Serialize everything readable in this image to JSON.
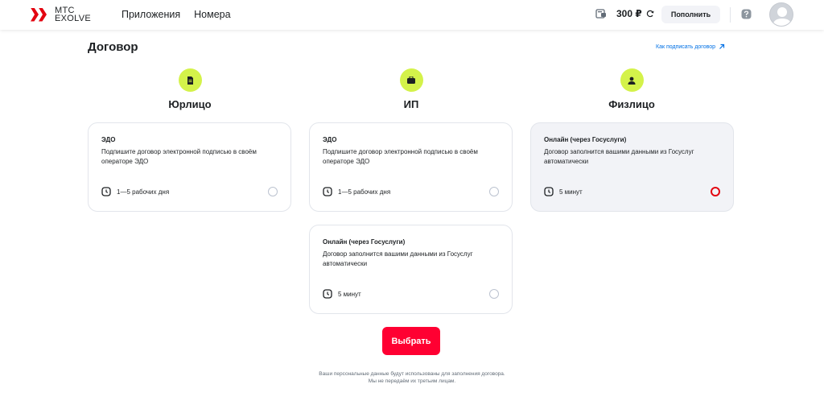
{
  "header": {
    "logo_line1": "МТС",
    "logo_line2": "EXOLVE",
    "nav": [
      "Приложения",
      "Номера"
    ],
    "balance": "300 ₽",
    "topup_label": "Пополнить",
    "icons": [
      "wallet-icon",
      "refresh-icon",
      "help-icon",
      "avatar-icon"
    ]
  },
  "page": {
    "title": "Договор",
    "howto_link": "Как подписать договор"
  },
  "columns": [
    {
      "title": "Юрлицо",
      "icon": "document-icon"
    },
    {
      "title": "ИП",
      "icon": "briefcase-icon"
    },
    {
      "title": "Физлицо",
      "icon": "person-icon"
    }
  ],
  "cards": {
    "ul_edo": {
      "title": "ЭДО",
      "desc": "Подпишите договор электронной подписью в своём операторе ЭДО",
      "time": "1—5 рабочих дня",
      "selected": false
    },
    "ip_edo": {
      "title": "ЭДО",
      "desc": "Подпишите договор электронной подписью в своём операторе ЭДО",
      "time": "1—5 рабочих дня",
      "selected": false
    },
    "ip_online": {
      "title": "Онлайн (через Госуслуги)",
      "desc": "Договор заполнится вашими данными из Госуслуг автоматически",
      "time": "5 минут",
      "selected": false
    },
    "fl_online": {
      "title": "Онлайн (через Госуслуги)",
      "desc": "Договор заполнится вашими данными из Госуслуг автоматически",
      "time": "5 минут",
      "selected": true
    }
  },
  "submit_label": "Выбрать",
  "disclaimer_line1": "Ваши персональные данные будут использованы для заполнения договора.",
  "disclaimer_line2": "Мы не передаём их третьим лицам.",
  "colors": {
    "accent": "#ff0032",
    "lime": "#d4f24a",
    "link": "#0070e5",
    "selected_bg": "#f2f3f7"
  }
}
